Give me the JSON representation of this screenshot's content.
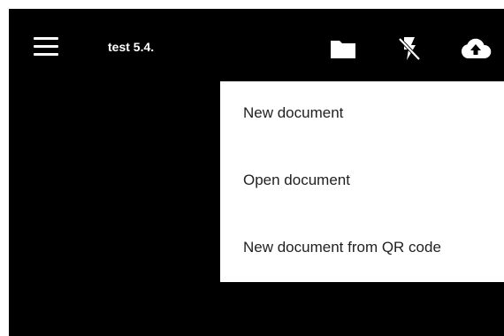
{
  "toolbar": {
    "title": "test 5.4.",
    "icons": {
      "menu": "hamburger-menu-icon",
      "folder": "folder-icon",
      "flash": "flash-off-icon",
      "upload": "cloud-upload-icon"
    },
    "colors": {
      "background": "#000000",
      "foreground": "#ffffff"
    }
  },
  "dropdown": {
    "items": [
      {
        "label": "New document"
      },
      {
        "label": "Open document"
      },
      {
        "label": "New document from QR code"
      }
    ],
    "colors": {
      "background": "#ffffff",
      "text": "#212121"
    }
  }
}
